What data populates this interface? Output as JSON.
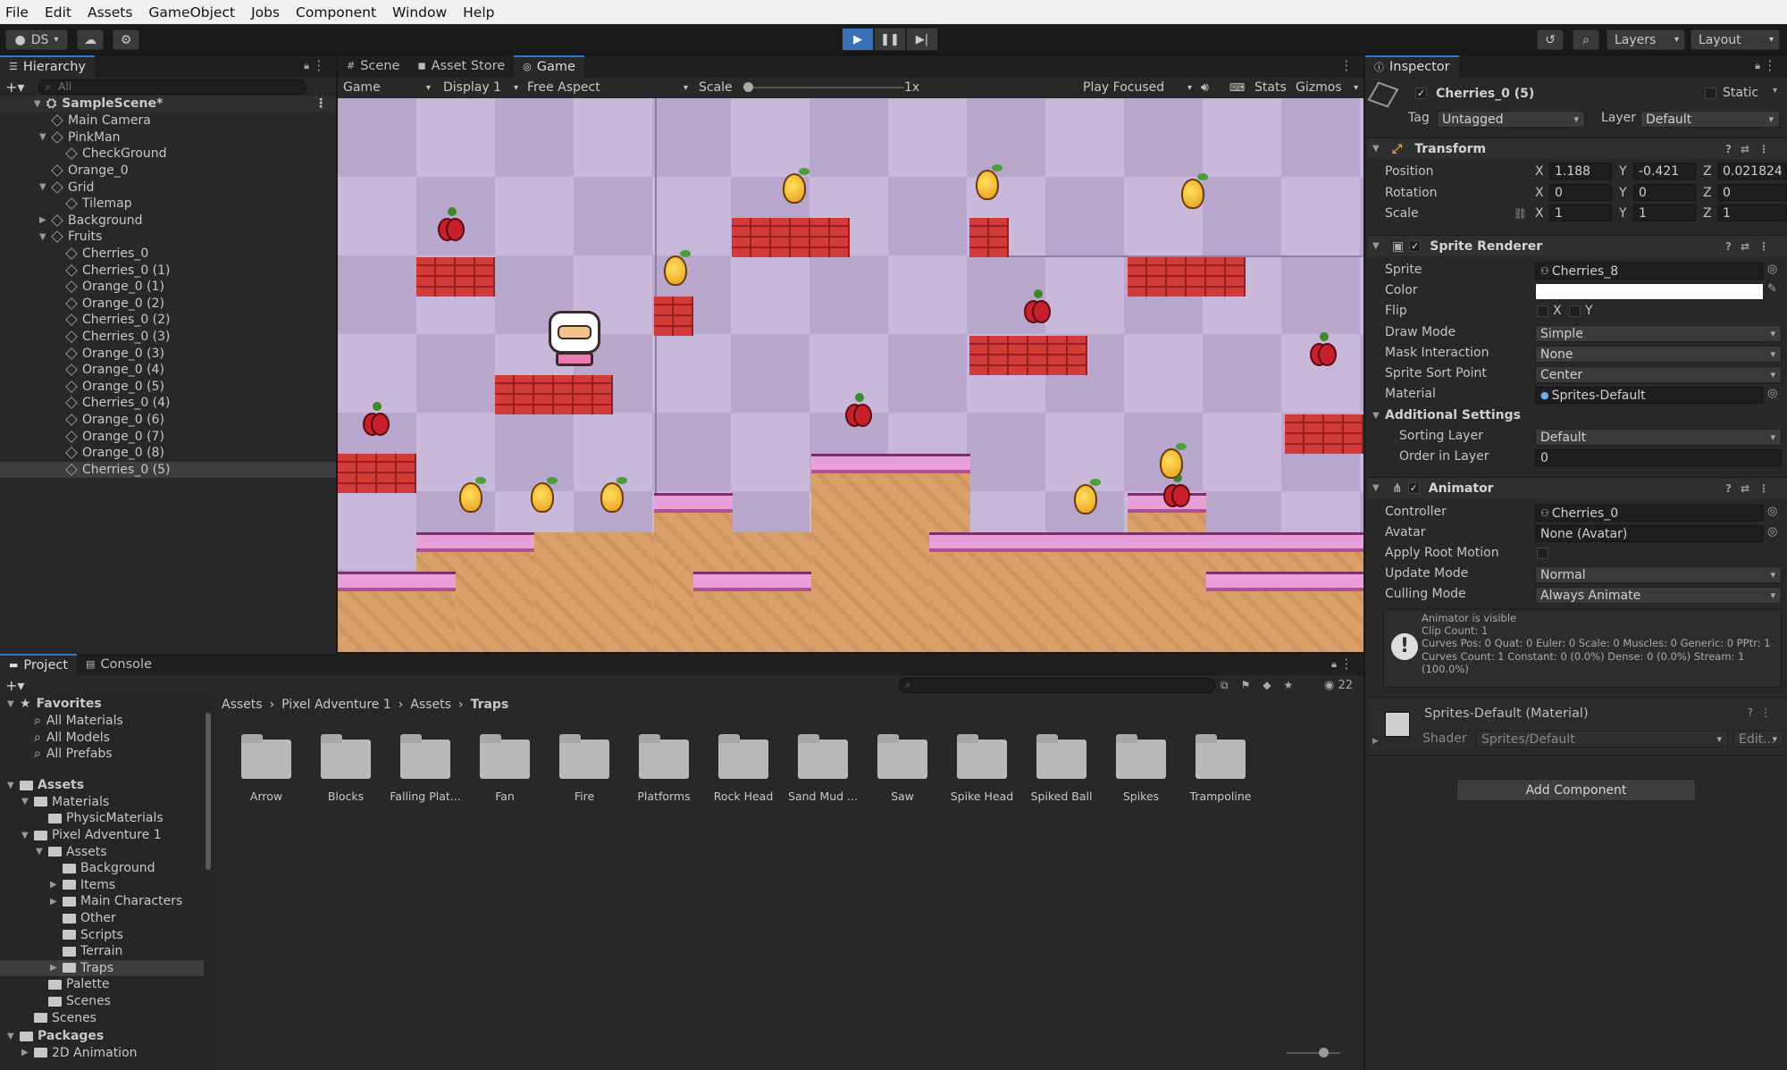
{
  "menu": [
    "File",
    "Edit",
    "Assets",
    "GameObject",
    "Jobs",
    "Component",
    "Window",
    "Help"
  ],
  "toolbar": {
    "account": "DS",
    "layers": "Layers",
    "layout": "Layout"
  },
  "hierarchy": {
    "tab": "Hierarchy",
    "search_placeholder": "All",
    "scene": "SampleScene*",
    "items": [
      {
        "label": "Main Camera",
        "depth": 1
      },
      {
        "label": "PinkMan",
        "depth": 1
      },
      {
        "label": "CheckGround",
        "depth": 2
      },
      {
        "label": "Orange_0",
        "depth": 1
      },
      {
        "label": "Grid",
        "depth": 1
      },
      {
        "label": "Tilemap",
        "depth": 2
      },
      {
        "label": "Background",
        "depth": 1
      },
      {
        "label": "Fruits",
        "depth": 1
      },
      {
        "label": "Cherries_0",
        "depth": 2
      },
      {
        "label": "Cherries_0 (1)",
        "depth": 2
      },
      {
        "label": "Orange_0 (1)",
        "depth": 2
      },
      {
        "label": "Orange_0 (2)",
        "depth": 2
      },
      {
        "label": "Cherries_0 (2)",
        "depth": 2
      },
      {
        "label": "Cherries_0 (3)",
        "depth": 2
      },
      {
        "label": "Orange_0 (3)",
        "depth": 2
      },
      {
        "label": "Orange_0 (4)",
        "depth": 2
      },
      {
        "label": "Orange_0 (5)",
        "depth": 2
      },
      {
        "label": "Cherries_0 (4)",
        "depth": 2
      },
      {
        "label": "Orange_0 (6)",
        "depth": 2
      },
      {
        "label": "Orange_0 (7)",
        "depth": 2
      },
      {
        "label": "Orange_0 (8)",
        "depth": 2
      },
      {
        "label": "Cherries_0 (5)",
        "depth": 2
      }
    ]
  },
  "scene_tabs": [
    "Scene",
    "Asset Store",
    "Game"
  ],
  "game_bar": {
    "mode": "Game",
    "display": "Display 1",
    "aspect": "Free Aspect",
    "scale_label": "Scale",
    "scale_value": "1x",
    "play_focused": "Play Focused",
    "stats": "Stats",
    "gizmos": "Gizmos"
  },
  "inspector": {
    "tab": "Inspector",
    "object_name": "Cherries_0 (5)",
    "static": "Static",
    "tag_label": "Tag",
    "tag": "Untagged",
    "layer_label": "Layer",
    "layer": "Default",
    "transform": {
      "title": "Transform",
      "position_label": "Position",
      "position": [
        "1.188",
        "-0.421",
        "0.021824"
      ],
      "rotation_label": "Rotation",
      "rotation": [
        "0",
        "0",
        "0"
      ],
      "scale_label": "Scale",
      "scale": [
        "1",
        "1",
        "1"
      ]
    },
    "sprite_renderer": {
      "title": "Sprite Renderer",
      "sprite_label": "Sprite",
      "sprite": "Cherries_8",
      "color_label": "Color",
      "flip_label": "Flip",
      "draw_mode_label": "Draw Mode",
      "draw_mode": "Simple",
      "mask_label": "Mask Interaction",
      "mask": "None",
      "sort_point_label": "Sprite Sort Point",
      "sort_point": "Center",
      "material_label": "Material",
      "material": "Sprites-Default",
      "additional": "Additional Settings",
      "sorting_layer_label": "Sorting Layer",
      "sorting_layer": "Default",
      "order_label": "Order in Layer",
      "order": "0"
    },
    "animator": {
      "title": "Animator",
      "controller_label": "Controller",
      "controller": "Cherries_0",
      "avatar_label": "Avatar",
      "avatar": "None (Avatar)",
      "root_motion_label": "Apply Root Motion",
      "update_mode_label": "Update Mode",
      "update_mode": "Normal",
      "culling_label": "Culling Mode",
      "culling": "Always Animate",
      "info": [
        "Animator is visible",
        "Clip Count: 1",
        "Curves Pos: 0 Quat: 0 Euler: 0 Scale: 0 Muscles: 0 Generic: 0 PPtr: 1",
        "Curves Count: 1 Constant: 0 (0.0%) Dense: 0 (0.0%) Stream: 1",
        "(100.0%)"
      ]
    },
    "material_block": {
      "name": "Sprites-Default (Material)",
      "shader_label": "Shader",
      "shader": "Sprites/Default",
      "edit": "Edit..."
    },
    "add_component": "Add Component"
  },
  "project": {
    "tabs": [
      "Project",
      "Console"
    ],
    "count": "22",
    "favorites": "Favorites",
    "fav_items": [
      "All Materials",
      "All Models",
      "All Prefabs"
    ],
    "tree": [
      {
        "label": "Assets",
        "depth": 0,
        "bold": true
      },
      {
        "label": "Materials",
        "depth": 1
      },
      {
        "label": "PhysicMaterials",
        "depth": 2
      },
      {
        "label": "Pixel Adventure 1",
        "depth": 1
      },
      {
        "label": "Assets",
        "depth": 2
      },
      {
        "label": "Background",
        "depth": 3
      },
      {
        "label": "Items",
        "depth": 3
      },
      {
        "label": "Main Characters",
        "depth": 3
      },
      {
        "label": "Other",
        "depth": 3
      },
      {
        "label": "Scripts",
        "depth": 3
      },
      {
        "label": "Terrain",
        "depth": 3
      },
      {
        "label": "Traps",
        "depth": 3
      },
      {
        "label": "Palette",
        "depth": 2
      },
      {
        "label": "Scenes",
        "depth": 2
      },
      {
        "label": "Scenes",
        "depth": 1
      },
      {
        "label": "Packages",
        "depth": 0,
        "bold": true
      },
      {
        "label": "2D Animation",
        "depth": 1
      }
    ],
    "breadcrumb": [
      "Assets",
      "Pixel Adventure 1",
      "Assets",
      "Traps"
    ],
    "assets": [
      "Arrow",
      "Blocks",
      "Falling Plat...",
      "Fan",
      "Fire",
      "Platforms",
      "Rock Head",
      "Sand Mud ...",
      "Saw",
      "Spike Head",
      "Spiked Ball",
      "Spikes",
      "Trampoline"
    ]
  }
}
